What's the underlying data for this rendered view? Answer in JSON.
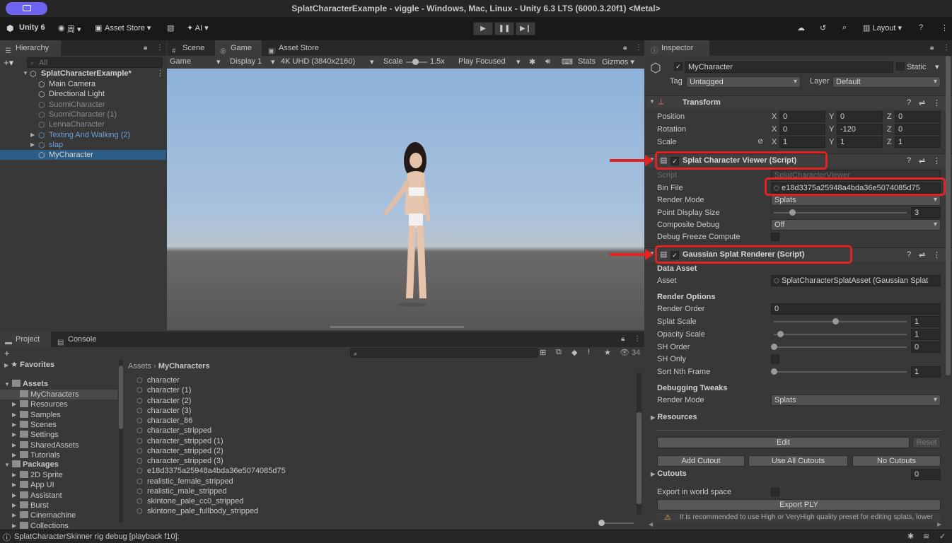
{
  "window": {
    "title": "SplatCharacterExample - viggle - Windows, Mac, Linux - Unity 6.3 LTS (6000.3.20f1) <Metal>"
  },
  "toolbar": {
    "account": "Unity 6",
    "user": "周",
    "asset_store": "Asset Store",
    "ai": "AI",
    "layout": "Layout"
  },
  "hierarchy": {
    "tab": "Hierarchy",
    "search_placeholder": "All",
    "scene": "SplatCharacterExample*",
    "items": [
      {
        "label": "Main Camera",
        "style": "normal"
      },
      {
        "label": "Directional Light",
        "style": "normal"
      },
      {
        "label": "SuomiCharacter",
        "style": "muted"
      },
      {
        "label": "SuomiCharacter (1)",
        "style": "muted"
      },
      {
        "label": "LennaCharacter",
        "style": "muted"
      },
      {
        "label": "Texting And Walking (2)",
        "style": "blue"
      },
      {
        "label": "slap",
        "style": "blue"
      },
      {
        "label": "MyCharacter",
        "style": "selected"
      }
    ]
  },
  "center_tabs": [
    "Scene",
    "Game",
    "Asset Store"
  ],
  "game_toolbar": {
    "mode": "Game",
    "display": "Display 1",
    "resolution": "4K UHD (3840x2160)",
    "scale_label": "Scale",
    "scale_value": "1.5x",
    "play_mode": "Play Focused",
    "stats": "Stats",
    "gizmos": "Gizmos"
  },
  "inspector": {
    "tab": "Inspector",
    "object_name": "MyCharacter",
    "static_label": "Static",
    "tag_label": "Tag",
    "tag_value": "Untagged",
    "layer_label": "Layer",
    "layer_value": "Default",
    "transform": {
      "title": "Transform",
      "position": {
        "label": "Position",
        "x": "0",
        "y": "0",
        "z": "0"
      },
      "rotation": {
        "label": "Rotation",
        "x": "0",
        "y": "-120",
        "z": "0"
      },
      "scale": {
        "label": "Scale",
        "x": "1",
        "y": "1",
        "z": "1"
      }
    },
    "viewer": {
      "title": "Splat Character Viewer (Script)",
      "script_label": "Script",
      "script_value": "SplatCharacterViewer",
      "bin_label": "Bin File",
      "bin_value": "e18d3375a25948a4bda36e5074085d75",
      "render_mode_label": "Render Mode",
      "render_mode_value": "Splats",
      "point_size_label": "Point Display Size",
      "point_size_value": "3",
      "composite_label": "Composite Debug",
      "composite_value": "Off",
      "freeze_label": "Debug Freeze Compute"
    },
    "renderer": {
      "title": "Gaussian Splat Renderer (Script)",
      "data_asset": "Data Asset",
      "asset_label": "Asset",
      "asset_value": "SplatCharacterSplatAsset (Gaussian Splat",
      "render_options": "Render Options",
      "render_order_label": "Render Order",
      "render_order_value": "0",
      "splat_scale_label": "Splat Scale",
      "splat_scale_value": "1",
      "opacity_label": "Opacity Scale",
      "opacity_value": "1",
      "sh_order_label": "SH Order",
      "sh_order_value": "0",
      "sh_only_label": "SH Only",
      "sort_label": "Sort Nth Frame",
      "sort_value": "1",
      "debug_tweaks": "Debugging Tweaks",
      "debug_render_label": "Render Mode",
      "debug_render_value": "Splats",
      "resources": "Resources",
      "edit": "Edit",
      "reset": "Reset",
      "add_cutout": "Add Cutout",
      "use_all": "Use All Cutouts",
      "no_cutouts": "No Cutouts",
      "cutouts_label": "Cutouts",
      "cutouts_value": "0",
      "export_world": "Export in world space",
      "export_ply": "Export PLY",
      "warning": "It is recommended to use High or VeryHigh quality preset for editing splats, lower"
    }
  },
  "project": {
    "tab": "Project",
    "console_tab": "Console",
    "count": "34",
    "favorites": "Favorites",
    "assets": "Assets",
    "folders": [
      "MyCharacters",
      "Resources",
      "Samples",
      "Scenes",
      "Settings",
      "SharedAssets",
      "Tutorials"
    ],
    "packages": "Packages",
    "package_items": [
      "2D Sprite",
      "App UI",
      "Assistant",
      "Burst",
      "Cinemachine",
      "Collections"
    ],
    "breadcrumb_root": "Assets",
    "breadcrumb_leaf": "MyCharacters",
    "files": [
      "character",
      "character (1)",
      "character (2)",
      "character (3)",
      "character_86",
      "character_stripped",
      "character_stripped (1)",
      "character_stripped (2)",
      "character_stripped (3)",
      "e18d3375a25948a4bda36e5074085d75",
      "realistic_female_stripped",
      "realistic_male_stripped",
      "skintone_pale_cc0_stripped",
      "skintone_pale_fullbody_stripped"
    ]
  },
  "status": {
    "message": "SplatCharacterSkinner rig debug [playback f10]:"
  }
}
